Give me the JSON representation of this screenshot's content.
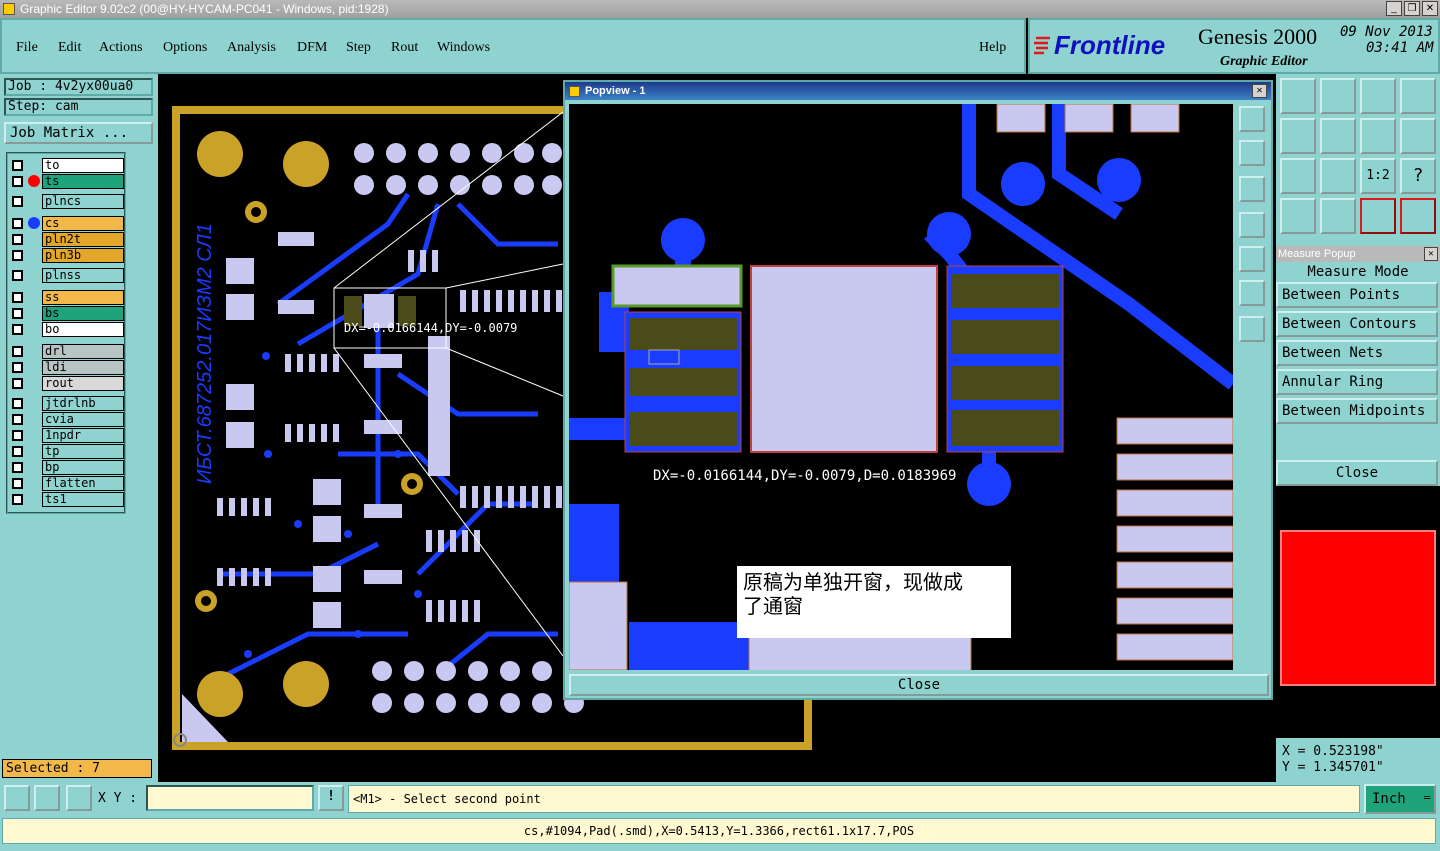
{
  "window": {
    "title": "Graphic Editor 9.02c2 (00@HY-HYCAM-PC041 - Windows, pid:1928)",
    "buttons": [
      "_",
      "❐",
      "✕"
    ]
  },
  "menu": {
    "items": [
      "File",
      "Edit",
      "Actions",
      "Options",
      "Analysis",
      "DFM",
      "Step",
      "Rout",
      "Windows"
    ],
    "help": "Help"
  },
  "brand": {
    "logo": "Frontline",
    "product": "Genesis 2000",
    "subtitle": "Graphic Editor",
    "date": "09 Nov 2013",
    "time": "03:41 AM"
  },
  "job": {
    "job_label": "Job : 4v2yx00ua0",
    "step_label": "Step: cam",
    "matrix_button": "Job Matrix ..."
  },
  "layers": [
    {
      "name": "to",
      "color": "#ffffff",
      "dot": ""
    },
    {
      "name": "ts",
      "color": "#1fa37a",
      "dot": "#ff0000"
    },
    {
      "name": "plncs",
      "color": "#8fd3d0",
      "dot": ""
    },
    {
      "name": "cs",
      "color": "#f2b84a",
      "dot": "#1a3cff"
    },
    {
      "name": "pln2t",
      "color": "#e3a82a",
      "dot": ""
    },
    {
      "name": "pln3b",
      "color": "#e3a82a",
      "dot": ""
    },
    {
      "name": "plnss",
      "color": "#8fd3d0",
      "dot": ""
    },
    {
      "name": "ss",
      "color": "#f2b84a",
      "dot": ""
    },
    {
      "name": "bs",
      "color": "#1fa37a",
      "dot": ""
    },
    {
      "name": "bo",
      "color": "#ffffff",
      "dot": ""
    },
    {
      "name": "drl",
      "color": "#b8c4c4",
      "dot": ""
    },
    {
      "name": "ldi",
      "color": "#b8c4c4",
      "dot": ""
    },
    {
      "name": "rout",
      "color": "#d8d8d8",
      "dot": ""
    },
    {
      "name": "jtdrlnb",
      "color": "#8fd3d0",
      "dot": ""
    },
    {
      "name": "cvia",
      "color": "#8fd3d0",
      "dot": ""
    },
    {
      "name": "1npdr",
      "color": "#8fd3d0",
      "dot": ""
    },
    {
      "name": "tp",
      "color": "#8fd3d0",
      "dot": ""
    },
    {
      "name": "bp",
      "color": "#8fd3d0",
      "dot": ""
    },
    {
      "name": "flatten",
      "color": "#8fd3d0",
      "dot": ""
    },
    {
      "name": "ts1",
      "color": "#8fd3d0",
      "dot": ""
    }
  ],
  "selected": "Selected : 7",
  "canvas": {
    "board_text": "ИБСТ.687252.017ИЗМ2 СЛ1",
    "measure_text": "DX=-0.0166144,DY=-0.0079"
  },
  "popview": {
    "title": "Popview - 1",
    "measure_text": "DX=-0.0166144,DY=-0.0079,D=0.0183969",
    "note_line1": "原稿为单独开窗，现做成",
    "note_line2": "了通窗",
    "close": "Close"
  },
  "measure_popup": {
    "title": "Measure Popup",
    "mode_label": "Measure Mode",
    "modes": [
      "Between Points",
      "Between Contours",
      "Between Nets",
      "Annular Ring",
      "Between Midpoints"
    ],
    "close": "Close"
  },
  "coords": {
    "x": "X = 0.523198\"",
    "y": "Y = 1.345701\""
  },
  "bottom": {
    "xy_label": "X Y :",
    "xy_value": "",
    "excl": "!",
    "prompt": "<M1> - Select second point",
    "units": "Inch"
  },
  "status": "cs,#1094,Pad(.smd),X=0.5413,Y=1.3366,rect61.1x17.7,POS",
  "colors": {
    "teal": "#8fd3d0",
    "gold": "#c9a227",
    "blue": "#1a3cff",
    "pad": "#c8c8f0",
    "olive": "#4b4b1a"
  }
}
